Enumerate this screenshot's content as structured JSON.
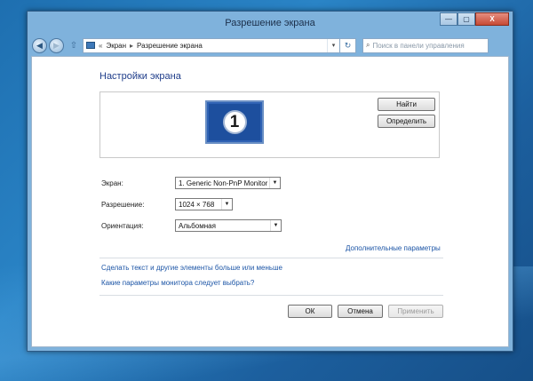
{
  "window": {
    "title": "Разрешение экрана",
    "controls": {
      "minimize": "—",
      "maximize": "▢",
      "close": "X"
    }
  },
  "nav": {
    "back": "◀",
    "forward": "▶",
    "up": "⇧",
    "breadcrumb": [
      "«",
      "Экран",
      "▸",
      "Разрешение экрана"
    ],
    "dropdown": "▾",
    "refresh": "↻",
    "search_placeholder": "Поиск в панели управления",
    "search_icon": "search-icon"
  },
  "main": {
    "heading": "Настройки экрана",
    "monitor_number": "1",
    "find_button": "Найти",
    "identify_button": "Определить",
    "display_label": "Экран:",
    "display_value": "1. Generic Non-PnP Monitor",
    "resolution_label": "Разрешение:",
    "resolution_value": "1024 × 768",
    "orientation_label": "Ориентация:",
    "orientation_value": "Альбомная",
    "advanced_link": "Дополнительные параметры",
    "text_size_link": "Сделать текст и другие элементы больше или меньше",
    "monitor_help_link": "Какие параметры монитора следует выбрать?",
    "ok_button": "ОК",
    "cancel_button": "Отмена",
    "apply_button": "Применить"
  }
}
